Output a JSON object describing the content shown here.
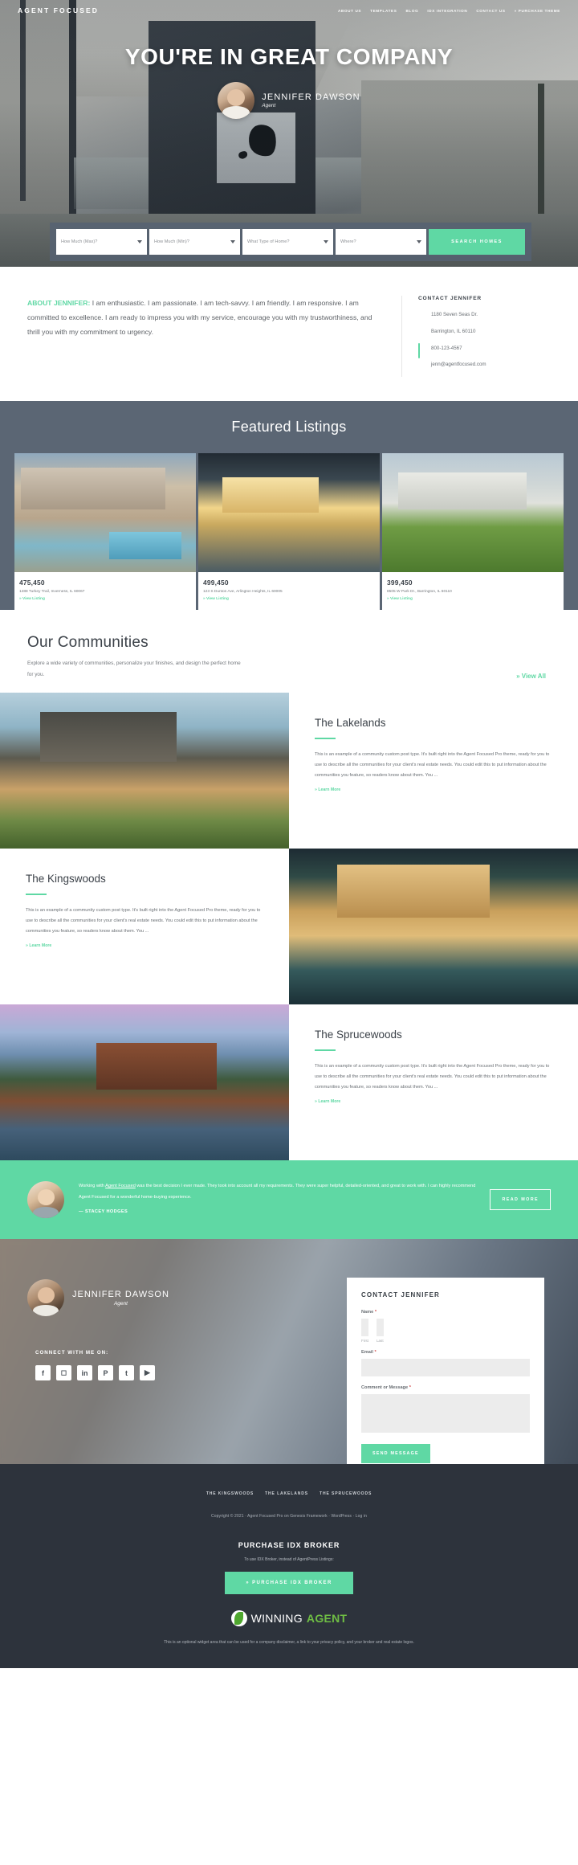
{
  "header": {
    "brand": "AGENT FOCUSED",
    "nav": [
      {
        "label": "ABOUT US"
      },
      {
        "label": "TEMPLATES"
      },
      {
        "label": "BLOG"
      },
      {
        "label": "IDX INTEGRATION"
      },
      {
        "label": "CONTACT US"
      },
      {
        "label": "» PURCHASE THEME"
      }
    ]
  },
  "hero": {
    "title": "YOU'RE IN GREAT COMPANY",
    "agent_name": "JENNIFER DAWSON",
    "agent_role": "Agent",
    "search": {
      "fields": [
        {
          "placeholder": "How Much (Max)?"
        },
        {
          "placeholder": "How Much (Min)?"
        },
        {
          "placeholder": "What Type of Home?"
        },
        {
          "placeholder": "Where?"
        }
      ],
      "button": "SEARCH HOMES"
    }
  },
  "about": {
    "label": "ABOUT JENNIFER:",
    "text": " I am enthusiastic. I am passionate. I am tech-savvy. I am friendly. I am responsive. I am committed to excellence. I am ready to impress you with my service, encourage you with my trustworthiness, and thrill you with my commitment to urgency.",
    "contact_heading": "CONTACT JENNIFER",
    "address_line1": "1180 Seven Seas Dr.",
    "address_line2": "Barrington, IL 60110",
    "phone": "800-123-4567",
    "email": "jenn@agentfocused.com"
  },
  "featured": {
    "heading": "Featured Listings",
    "listings": [
      {
        "price": "475,450",
        "address": "1488 Turkey Trail,  Inverness, IL 60067",
        "link": "» View Listing"
      },
      {
        "price": "499,450",
        "address": "123 S Dunton Ave, Arlington Heights, IL 60005",
        "link": "» View Listing"
      },
      {
        "price": "399,450",
        "address": "8505 W Park Dr.,  Barrington, IL 60110",
        "link": "» View Listing"
      }
    ]
  },
  "communities": {
    "heading": "Our Communities",
    "subtext": "Explore a wide variety of communities, personalize your finishes, and design the perfect home for you.",
    "view_all": "» View All",
    "body_text": "This is an example of a community custom post type. It's built right into the Agent Focused Pro theme, ready for you to use to describe all the communities for your client's real estate needs. You could edit this to put information about the communities you feature, so readers know about them. You ...",
    "learn_more": "» Learn More",
    "items": [
      {
        "title": "The Lakelands"
      },
      {
        "title": "The Kingswoods"
      },
      {
        "title": "The Sprucewoods"
      }
    ]
  },
  "testimonial": {
    "text_before": "Working with ",
    "link": "Agent Focused",
    "text_after": " was the best decision I ever made. They took into account all my requirements. They were super helpful, detailed-oriented, and great to work with. I can highly recommend Agent Focused for a wonderful home-buying experience.",
    "author": "— STACEY HODGES",
    "button": "READ MORE"
  },
  "contact_section": {
    "agent_name": "JENNIFER DAWSON",
    "agent_role": "Agent",
    "connect_label": "CONNECT WITH ME ON:",
    "socials": [
      {
        "name": "facebook-icon",
        "glyph": "f"
      },
      {
        "name": "instagram-icon",
        "glyph": "◻"
      },
      {
        "name": "linkedin-icon",
        "glyph": "in"
      },
      {
        "name": "pinterest-icon",
        "glyph": "P"
      },
      {
        "name": "twitter-icon",
        "glyph": "t"
      },
      {
        "name": "youtube-icon",
        "glyph": "▶"
      }
    ],
    "form": {
      "heading": "CONTACT JENNIFER",
      "name_label": "Name",
      "first_hint": "First",
      "last_hint": "Last",
      "email_label": "Email",
      "message_label": "Comment or Message",
      "submit": "SEND MESSAGE",
      "required_mark": "*"
    }
  },
  "footer": {
    "nav": [
      {
        "label": "THE KINGSWOODS"
      },
      {
        "label": "THE LAKELANDS"
      },
      {
        "label": "THE SPRUCEWOODS"
      }
    ],
    "copyright": "Copyright © 2021 · Agent Focused Pro on Genesis Framework · WordPress · Log in",
    "idx_heading": "PURCHASE IDX BROKER",
    "idx_sub": "To use IDX Broker, instead of AgentPress Listings:",
    "idx_button": "» PURCHASE IDX BROKER",
    "logo_part1": "WINNING",
    "logo_part2": "AGENT",
    "disclaimer": "This is an optional widget area that can be used for a company disclaimer, a link to your privacy policy, and your broker and real estate logos."
  },
  "colors": {
    "accent": "#5fd8a4",
    "dark": "#2d333c",
    "slate": "#5b6674"
  }
}
